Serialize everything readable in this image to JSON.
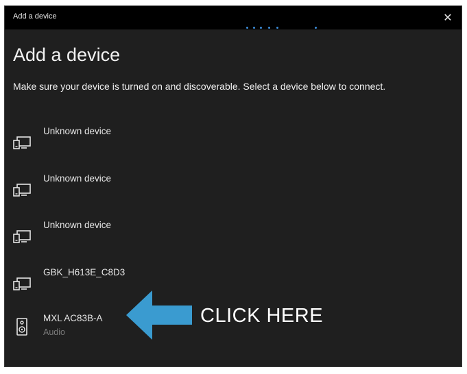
{
  "window": {
    "title": "Add a device",
    "close_glyph": "✕",
    "close_icon": "close-icon"
  },
  "page": {
    "heading": "Add a device",
    "subtitle": "Make sure your device is turned on and discoverable. Select a device below to connect."
  },
  "devices": [
    {
      "name": "Unknown device",
      "type": "",
      "icon": "display-icon"
    },
    {
      "name": "Unknown device",
      "type": "",
      "icon": "display-icon"
    },
    {
      "name": "Unknown device",
      "type": "",
      "icon": "display-icon"
    },
    {
      "name": "GBK_H613E_C8D3",
      "type": "",
      "icon": "display-icon"
    },
    {
      "name": "MXL AC83B-A",
      "type": "Audio",
      "icon": "speaker-icon"
    }
  ],
  "annotation": {
    "text": "CLICK HERE",
    "arrow_color": "#3a9bd0",
    "arrow_icon": "arrow-left-icon"
  },
  "colors": {
    "window_bg": "#1f1f1f",
    "titlebar_bg": "#000000",
    "accent": "#3b8bd6"
  }
}
